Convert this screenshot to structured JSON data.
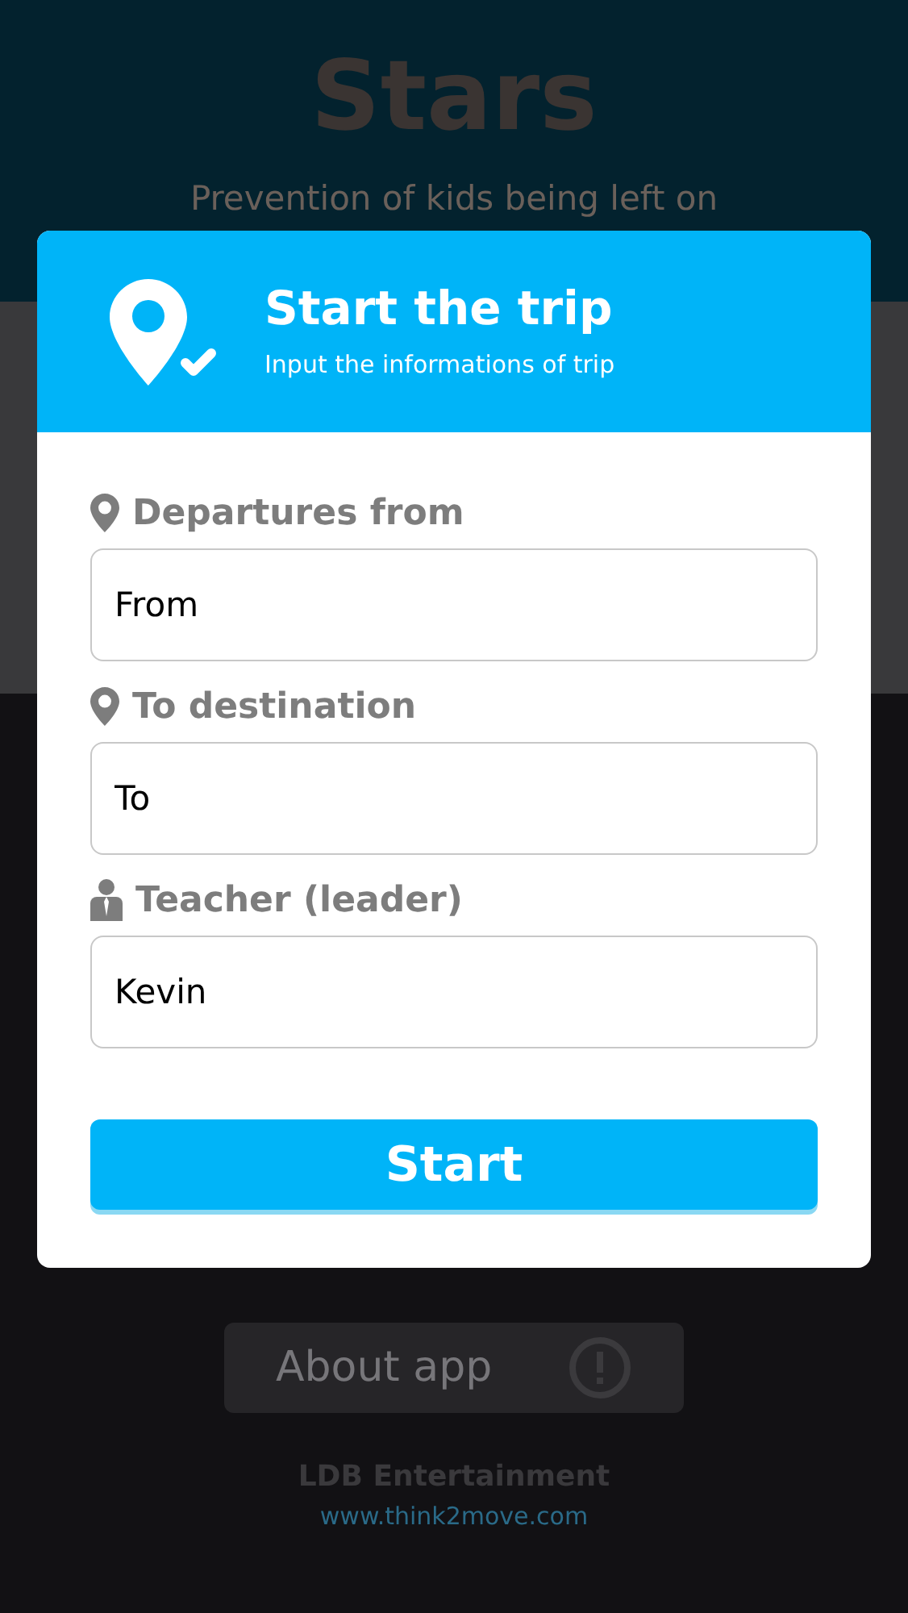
{
  "background": {
    "title": "Stars",
    "subtitle": "Prevention of kids being left on",
    "about_button": "About app",
    "company": "LDB Entertainment",
    "website": "www.think2move.com"
  },
  "dialog": {
    "title": "Start the trip",
    "subtitle": "Input the informations of trip",
    "fields": [
      {
        "kind": "place",
        "label": "Departures from",
        "value": "From"
      },
      {
        "kind": "place",
        "label": "To destination",
        "value": "To"
      },
      {
        "kind": "person",
        "label": "Teacher (leader)",
        "value": "Kevin"
      }
    ],
    "button": "Start"
  }
}
